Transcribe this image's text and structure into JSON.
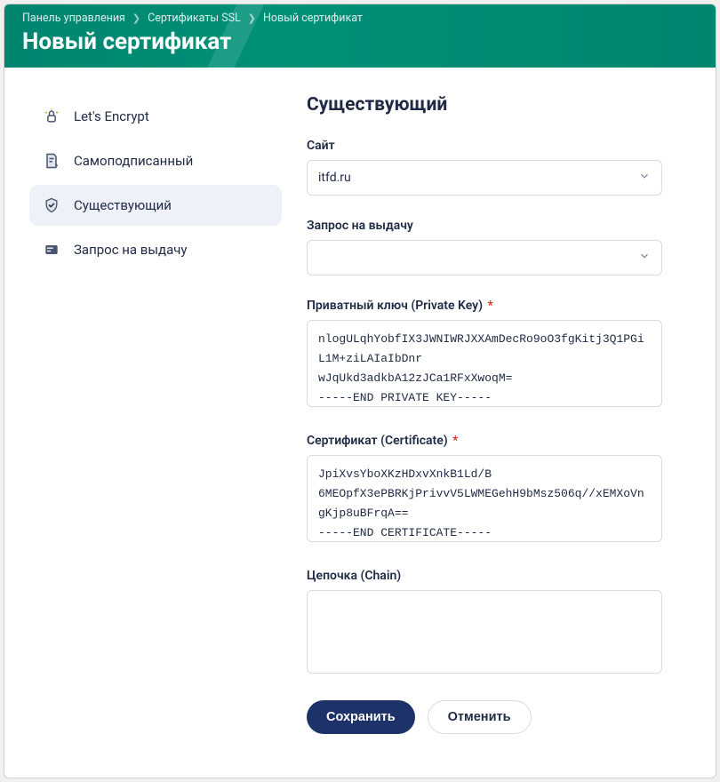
{
  "breadcrumb": {
    "items": [
      "Панель управления",
      "Сертификаты SSL",
      "Новый сертификат"
    ]
  },
  "page_title": "Новый сертификат",
  "sidebar": {
    "items": [
      {
        "label": "Let's Encrypt",
        "icon": "letsencrypt"
      },
      {
        "label": "Самоподписанный",
        "icon": "selfsigned"
      },
      {
        "label": "Существующий",
        "icon": "existing",
        "active": true
      },
      {
        "label": "Запрос на выдачу",
        "icon": "csr"
      }
    ]
  },
  "form": {
    "title": "Существующий",
    "site": {
      "label": "Сайт",
      "value": "itfd.ru"
    },
    "csr": {
      "label": "Запрос на выдачу",
      "value": ""
    },
    "private_key": {
      "label": "Приватный ключ (Private Key)",
      "required": true,
      "value": "nlogULqhYobfIX3JWNIWRJXXAmDecRo9oO3fgKitj3Q1PGiL1M+ziLAIaIbDnr\nwJqUkd3adkbA12zJCa1RFxXwoqM=\n-----END PRIVATE KEY-----"
    },
    "certificate": {
      "label": "Сертификат (Certificate)",
      "required": true,
      "value": "JpiXvsYboXKzHDxvXnkB1Ld/B\n6MEOpfX3ePBRKjPrivvV5LWMEGehH9bMsz506q//xEMXoVngKjp8uBFrqA==\n-----END CERTIFICATE-----"
    },
    "chain": {
      "label": "Цепочка (Chain)",
      "required": false,
      "value": ""
    },
    "buttons": {
      "save": "Сохранить",
      "cancel": "Отменить"
    }
  }
}
